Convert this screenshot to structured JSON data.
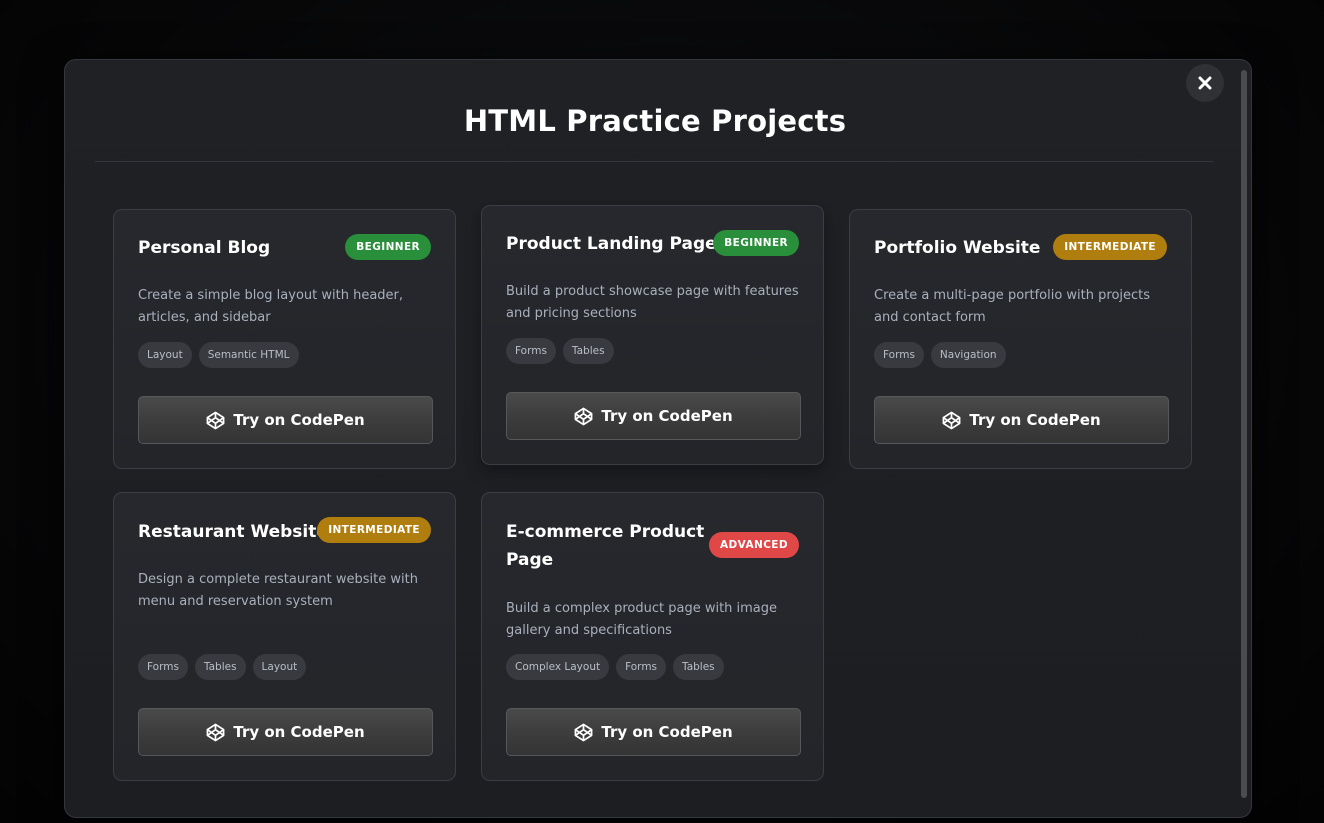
{
  "modal": {
    "title": "HTML Practice Projects",
    "close_icon": "close-icon"
  },
  "colors": {
    "beginner": "#2a8f3b",
    "intermediate": "#b07d0f",
    "advanced": "#e04848"
  },
  "projects": [
    {
      "title": "Personal Blog",
      "level": "BEGINNER",
      "level_color": "#2a8f3b",
      "description": "Create a simple blog layout with header, articles, and sidebar",
      "tags": [
        "Layout",
        "Semantic HTML"
      ],
      "button_label": "Try on CodePen",
      "button_icon": "codepen-icon"
    },
    {
      "title": "Product Landing Page",
      "level": "BEGINNER",
      "level_color": "#2a8f3b",
      "description": "Build a product showcase page with features and pricing sections",
      "tags": [
        "Forms",
        "Tables"
      ],
      "button_label": "Try on CodePen",
      "button_icon": "codepen-icon"
    },
    {
      "title": "Portfolio Website",
      "level": "INTERMEDIATE",
      "level_color": "#b07d0f",
      "description": "Create a multi-page portfolio with projects and contact form",
      "tags": [
        "Forms",
        "Navigation"
      ],
      "button_label": "Try on CodePen",
      "button_icon": "codepen-icon"
    },
    {
      "title": "Restaurant Website",
      "level": "INTERMEDIATE",
      "level_color": "#b07d0f",
      "description": "Design a complete restaurant website with menu and reservation system",
      "tags": [
        "Forms",
        "Tables",
        "Layout"
      ],
      "button_label": "Try on CodePen",
      "button_icon": "codepen-icon"
    },
    {
      "title": "E-commerce Product Page",
      "level": "ADVANCED",
      "level_color": "#e04848",
      "description": "Build a complex product page with image gallery and specifications",
      "tags": [
        "Complex Layout",
        "Forms",
        "Tables"
      ],
      "button_label": "Try on CodePen",
      "button_icon": "codepen-icon"
    }
  ]
}
